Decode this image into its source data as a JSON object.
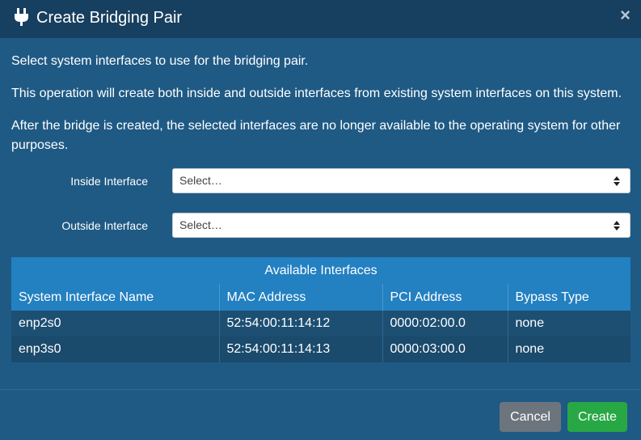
{
  "dialog": {
    "title": "Create Bridging Pair",
    "icon": "plug-icon",
    "close_symbol": "×"
  },
  "paragraphs": {
    "p1": "Select system interfaces to use for the bridging pair.",
    "p2": "This operation will create both inside and outside interfaces from existing system interfaces on this system.",
    "p3": "After the bridge is created, the selected interfaces are no longer available to the operating system for other purposes."
  },
  "form": {
    "inside_label": "Inside Interface",
    "inside_value": "Select…",
    "outside_label": "Outside Interface",
    "outside_value": "Select…"
  },
  "table": {
    "caption": "Available Interfaces",
    "headers": [
      "System Interface Name",
      "MAC Address",
      "PCI Address",
      "Bypass Type"
    ],
    "rows": [
      [
        "enp2s0",
        "52:54:00:11:14:12",
        "0000:02:00.0",
        "none"
      ],
      [
        "enp3s0",
        "52:54:00:11:14:13",
        "0000:03:00.0",
        "none"
      ]
    ]
  },
  "buttons": {
    "cancel": "Cancel",
    "create": "Create"
  },
  "colors": {
    "body_bg": "#1f5a84",
    "header_bg": "#173f5f",
    "table_header_bg": "#2380c1",
    "create_bg": "#28a745",
    "cancel_bg": "#6c757d"
  }
}
